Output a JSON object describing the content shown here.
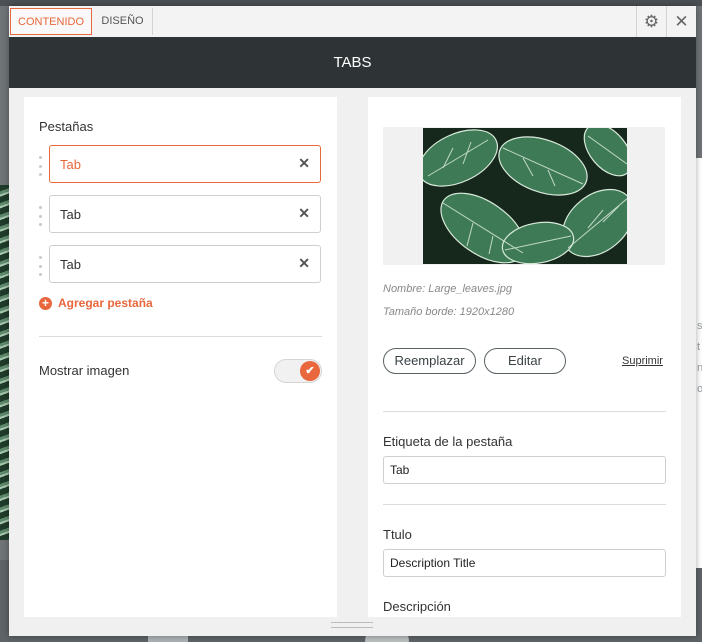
{
  "tabs": {
    "content": "CONTENIDO",
    "design": "DISEÑO"
  },
  "header": {
    "title": "TABS"
  },
  "icons": {
    "settings": "gear-icon",
    "close": "close-icon"
  },
  "left": {
    "section_label": "Pestañas",
    "items": [
      {
        "label": "Tab",
        "active": true
      },
      {
        "label": "Tab",
        "active": false
      },
      {
        "label": "Tab",
        "active": false
      }
    ],
    "add_label": "Agregar pestaña",
    "show_image_label": "Mostrar imagen",
    "show_image_on": true
  },
  "right": {
    "image_name": "Nombre: Large_leaves.jpg",
    "image_size": "Tamaño borde: 1920x1280",
    "replace_label": "Reemplazar",
    "edit_label": "Editar",
    "delete_label": "Suprimir",
    "tab_label_title": "Etiqueta de la pestaña",
    "tab_label_value": "Tab",
    "title_label": "Ttulo",
    "title_value": "Description Title",
    "description_label": "Descripción"
  },
  "background": {
    "right_letters": [
      "s",
      "t",
      "n",
      "o"
    ]
  },
  "colors": {
    "accent": "#e8673c",
    "header": "#2e3436"
  }
}
